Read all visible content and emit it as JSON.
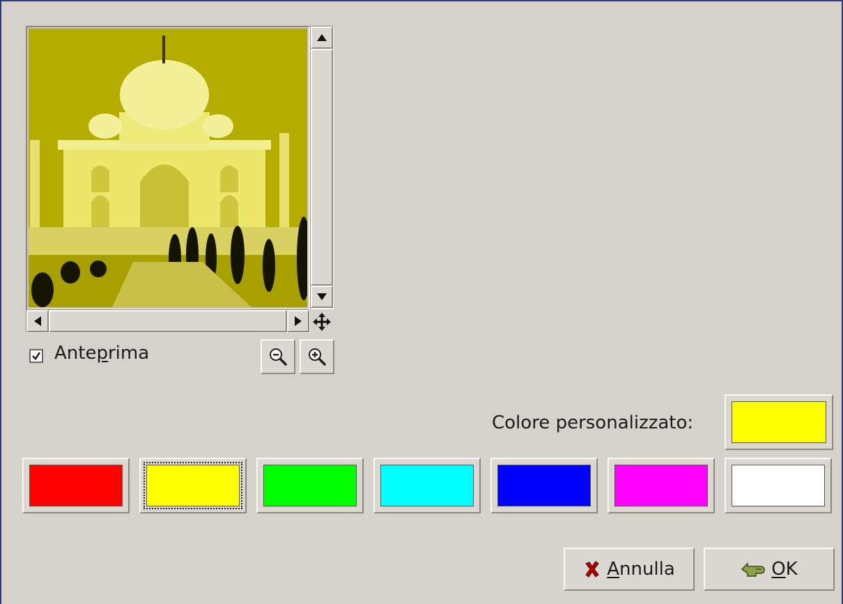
{
  "preview": {
    "checkbox_checked": true,
    "label_before": "Ante",
    "label_mnemonic": "p",
    "label_after": "rima",
    "tint_color": "#c8c400",
    "image_subject": "Taj Mahal"
  },
  "icons": {
    "scroll_up": "arrow-up-icon",
    "scroll_down": "arrow-down-icon",
    "scroll_left": "arrow-left-icon",
    "scroll_right": "arrow-right-icon",
    "navigate": "move-arrows-icon",
    "zoom_out": "zoom-out-icon",
    "zoom_in": "zoom-in-icon",
    "cancel": "cancel-x-icon",
    "ok": "ok-hand-icon"
  },
  "custom_color": {
    "label": "Colore personalizzato:",
    "value": "#ffff00"
  },
  "swatches": [
    {
      "name": "red",
      "color": "#ff0000"
    },
    {
      "name": "yellow",
      "color": "#ffff00",
      "selected": true
    },
    {
      "name": "green",
      "color": "#00ff00"
    },
    {
      "name": "cyan",
      "color": "#00ffff"
    },
    {
      "name": "blue",
      "color": "#0000ff"
    },
    {
      "name": "magenta",
      "color": "#ff00ff"
    },
    {
      "name": "white",
      "color": "#ffffff"
    }
  ],
  "buttons": {
    "cancel_mnemonic": "A",
    "cancel_rest": "nnulla",
    "ok_mnemonic": "O",
    "ok_rest": "K"
  }
}
